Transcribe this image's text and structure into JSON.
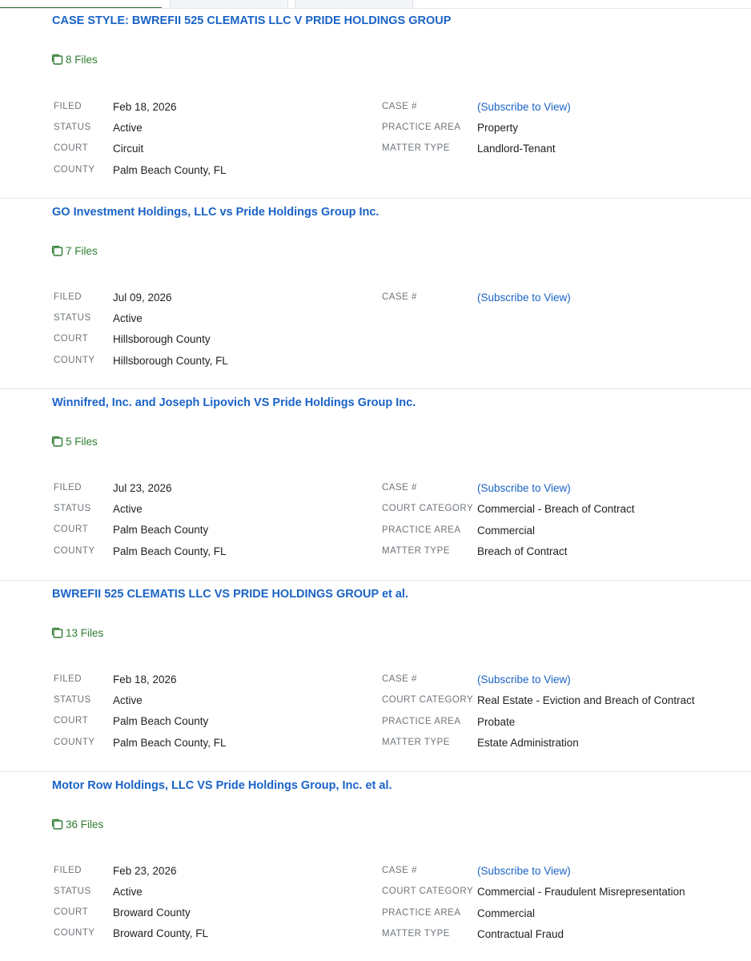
{
  "labels": {
    "filed": "FILED",
    "status": "STATUS",
    "court": "COURT",
    "county": "COUNTY",
    "case_no": "CASE #",
    "court_category": "COURT CATEGORY",
    "practice_area": "PRACTICE AREA",
    "matter_type": "MATTER TYPE"
  },
  "cases": [
    {
      "title": "CASE STYLE: BWREFII 525 CLEMATIS LLC V PRIDE HOLDINGS GROUP",
      "files": "8 Files",
      "filed": "Feb 18, 2026",
      "status": "Active",
      "court": "Circuit",
      "county": "Palm Beach County, FL",
      "case_no": "(Subscribe to View)",
      "practice_area": "Property",
      "matter_type": "Landlord-Tenant"
    },
    {
      "title": "GO Investment Holdings, LLC vs Pride Holdings Group Inc.",
      "files": "7 Files",
      "filed": "Jul 09, 2026",
      "status": "Active",
      "court": "Hillsborough County",
      "county": "Hillsborough County, FL",
      "case_no": "(Subscribe to View)"
    },
    {
      "title": "Winnifred, Inc. and Joseph Lipovich VS Pride Holdings Group Inc.",
      "files": "5 Files",
      "filed": "Jul 23, 2026",
      "status": "Active",
      "court": "Palm Beach County",
      "county": "Palm Beach County, FL",
      "case_no": "(Subscribe to View)",
      "court_category": "Commercial - Breach of Contract",
      "practice_area": "Commercial",
      "matter_type": "Breach of Contract"
    },
    {
      "title": "BWREFII 525 CLEMATIS LLC VS PRIDE HOLDINGS GROUP et al.",
      "files": "13 Files",
      "filed": "Feb 18, 2026",
      "status": "Active",
      "court": "Palm Beach County",
      "county": "Palm Beach County, FL",
      "case_no": "(Subscribe to View)",
      "court_category": "Real Estate - Eviction and Breach of Contract",
      "practice_area": "Probate",
      "matter_type": "Estate Administration"
    },
    {
      "title": "Motor Row Holdings, LLC VS Pride Holdings Group, Inc. et al.",
      "files": "36 Files",
      "filed": "Feb 23, 2026",
      "status": "Active",
      "court": "Broward County",
      "county": "Broward County, FL",
      "case_no": "(Subscribe to View)",
      "court_category": "Commercial - Fraudulent Misrepresentation",
      "practice_area": "Commercial",
      "matter_type": "Contractual Fraud"
    }
  ]
}
